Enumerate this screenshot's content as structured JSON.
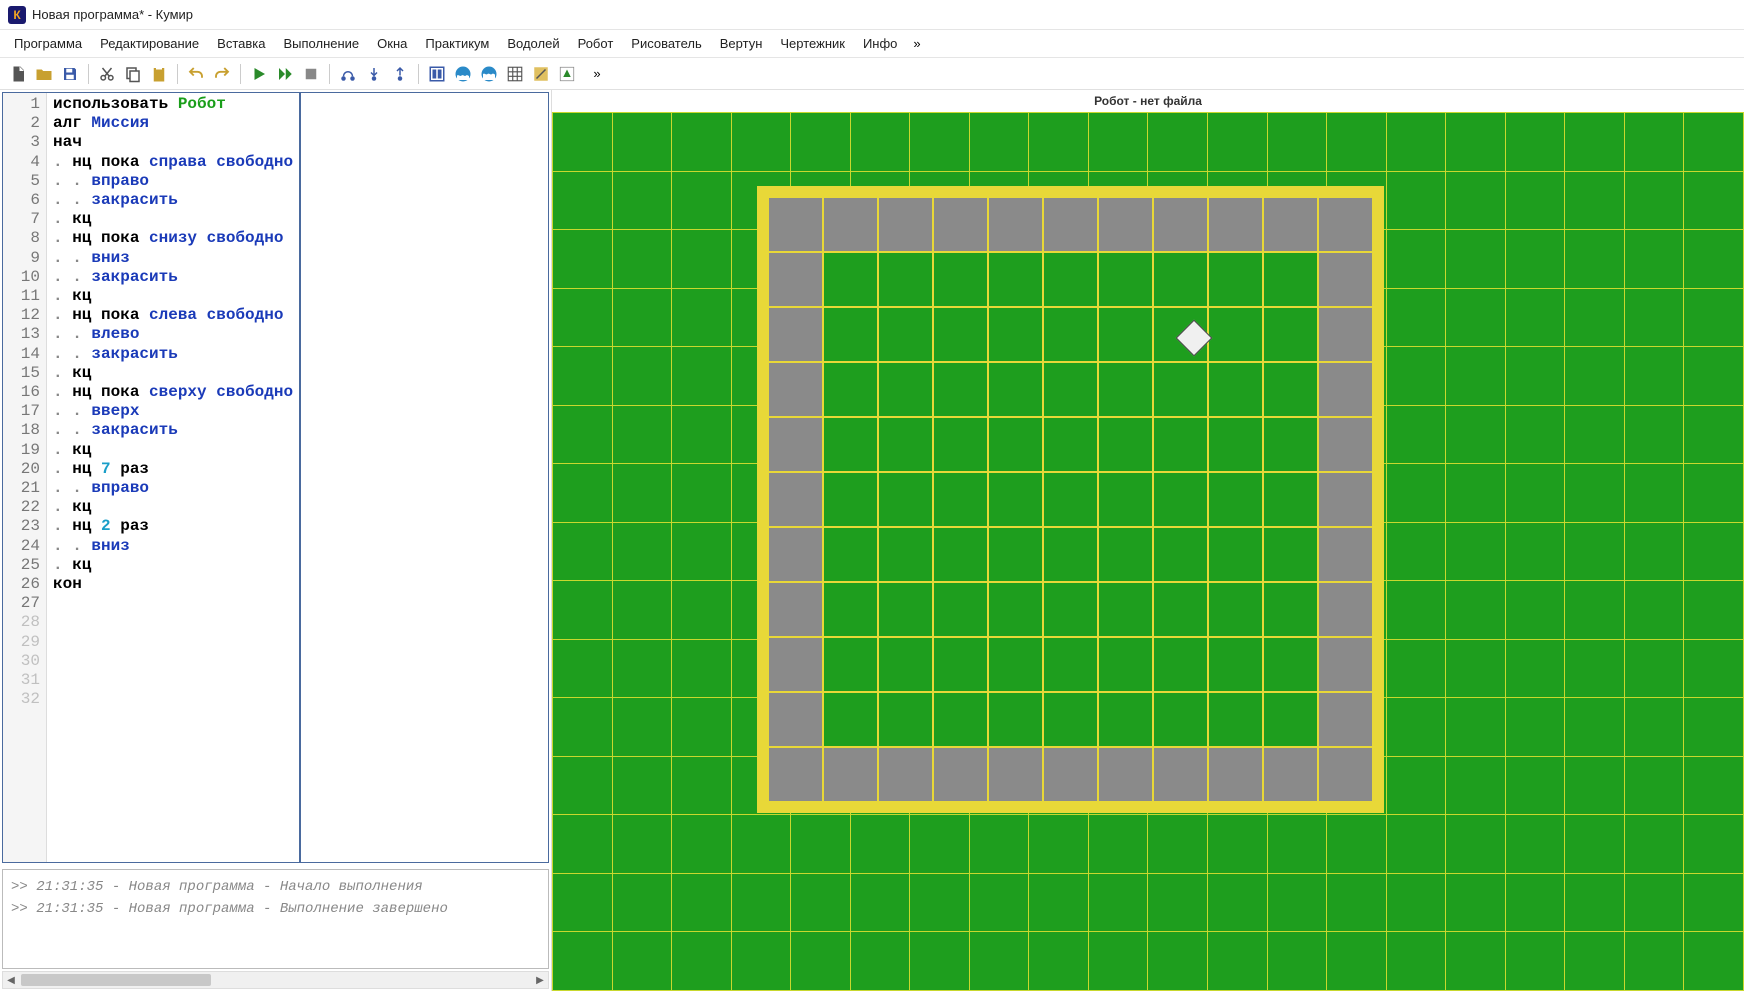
{
  "title": "Новая программа* - Кумир",
  "app_icon_letter": "К",
  "menu": [
    "Программа",
    "Редактирование",
    "Вставка",
    "Выполнение",
    "Окна",
    "Практикум",
    "Водолей",
    "Робот",
    "Рисователь",
    "Вертун",
    "Чертежник",
    "Инфо"
  ],
  "menu_more": "»",
  "toolbar_more": "»",
  "code_lines": [
    [
      {
        "t": "использовать ",
        "c": "kw-black"
      },
      {
        "t": "Робот",
        "c": "kw-green"
      }
    ],
    [
      {
        "t": "алг ",
        "c": "kw-black"
      },
      {
        "t": "Миссия",
        "c": "kw-blue"
      }
    ],
    [
      {
        "t": "нач",
        "c": "kw-black"
      }
    ],
    [
      {
        "t": ". ",
        "c": "dot"
      },
      {
        "t": "нц пока ",
        "c": "kw-black"
      },
      {
        "t": "справа свободно",
        "c": "kw-blue"
      }
    ],
    [
      {
        "t": ". . ",
        "c": "dot"
      },
      {
        "t": "вправо",
        "c": "kw-blue"
      }
    ],
    [
      {
        "t": ". . ",
        "c": "dot"
      },
      {
        "t": "закрасить",
        "c": "kw-blue"
      }
    ],
    [
      {
        "t": ". ",
        "c": "dot"
      },
      {
        "t": "кц",
        "c": "kw-black"
      }
    ],
    [
      {
        "t": ". ",
        "c": "dot"
      },
      {
        "t": "нц пока ",
        "c": "kw-black"
      },
      {
        "t": "снизу свободно",
        "c": "kw-blue"
      }
    ],
    [
      {
        "t": ". . ",
        "c": "dot"
      },
      {
        "t": "вниз",
        "c": "kw-blue"
      }
    ],
    [
      {
        "t": ". . ",
        "c": "dot"
      },
      {
        "t": "закрасить",
        "c": "kw-blue"
      }
    ],
    [
      {
        "t": ". ",
        "c": "dot"
      },
      {
        "t": "кц",
        "c": "kw-black"
      }
    ],
    [
      {
        "t": ". ",
        "c": "dot"
      },
      {
        "t": "нц пока ",
        "c": "kw-black"
      },
      {
        "t": "слева свободно",
        "c": "kw-blue"
      }
    ],
    [
      {
        "t": ". . ",
        "c": "dot"
      },
      {
        "t": "влево",
        "c": "kw-blue"
      }
    ],
    [
      {
        "t": ". . ",
        "c": "dot"
      },
      {
        "t": "закрасить",
        "c": "kw-blue"
      }
    ],
    [
      {
        "t": ". ",
        "c": "dot"
      },
      {
        "t": "кц",
        "c": "kw-black"
      }
    ],
    [
      {
        "t": ". ",
        "c": "dot"
      },
      {
        "t": "нц пока ",
        "c": "kw-black"
      },
      {
        "t": "сверху свободно",
        "c": "kw-blue"
      }
    ],
    [
      {
        "t": ". . ",
        "c": "dot"
      },
      {
        "t": "вверх",
        "c": "kw-blue"
      }
    ],
    [
      {
        "t": ". . ",
        "c": "dot"
      },
      {
        "t": "закрасить",
        "c": "kw-blue"
      }
    ],
    [
      {
        "t": ". ",
        "c": "dot"
      },
      {
        "t": "кц",
        "c": "kw-black"
      }
    ],
    [
      {
        "t": ". ",
        "c": "dot"
      },
      {
        "t": "нц ",
        "c": "kw-black"
      },
      {
        "t": "7",
        "c": "kw-cyan"
      },
      {
        "t": " раз",
        "c": "kw-black"
      }
    ],
    [
      {
        "t": ". . ",
        "c": "dot"
      },
      {
        "t": "вправо",
        "c": "kw-blue"
      }
    ],
    [
      {
        "t": ". ",
        "c": "dot"
      },
      {
        "t": "кц",
        "c": "kw-black"
      }
    ],
    [
      {
        "t": ". ",
        "c": "dot"
      },
      {
        "t": "нц ",
        "c": "kw-black"
      },
      {
        "t": "2",
        "c": "kw-cyan"
      },
      {
        "t": " раз",
        "c": "kw-black"
      }
    ],
    [
      {
        "t": ". . ",
        "c": "dot"
      },
      {
        "t": "вниз",
        "c": "kw-blue"
      }
    ],
    [
      {
        "t": ". ",
        "c": "dot"
      },
      {
        "t": "кц",
        "c": "kw-black"
      }
    ],
    [
      {
        "t": "кон",
        "c": "kw-black"
      }
    ],
    []
  ],
  "line_count": 27,
  "dim_lines": [
    28,
    29,
    30,
    31,
    32
  ],
  "console_lines": [
    ">> 21:31:35 - Новая программа - Начало выполнения",
    ">> 21:31:35 - Новая программа - Выполнение завершено"
  ],
  "robot_header": "Робот - нет файла",
  "field": {
    "cols": 11,
    "rows": 11,
    "painted": [
      [
        0,
        0
      ],
      [
        0,
        1
      ],
      [
        0,
        2
      ],
      [
        0,
        3
      ],
      [
        0,
        4
      ],
      [
        0,
        5
      ],
      [
        0,
        6
      ],
      [
        0,
        7
      ],
      [
        0,
        8
      ],
      [
        0,
        9
      ],
      [
        0,
        10
      ],
      [
        1,
        0
      ],
      [
        1,
        10
      ],
      [
        2,
        0
      ],
      [
        2,
        10
      ],
      [
        3,
        0
      ],
      [
        3,
        10
      ],
      [
        4,
        0
      ],
      [
        4,
        10
      ],
      [
        5,
        0
      ],
      [
        5,
        10
      ],
      [
        6,
        0
      ],
      [
        6,
        10
      ],
      [
        7,
        0
      ],
      [
        7,
        10
      ],
      [
        8,
        0
      ],
      [
        8,
        10
      ],
      [
        9,
        0
      ],
      [
        9,
        10
      ],
      [
        10,
        0
      ],
      [
        10,
        1
      ],
      [
        10,
        2
      ],
      [
        10,
        3
      ],
      [
        10,
        4
      ],
      [
        10,
        5
      ],
      [
        10,
        6
      ],
      [
        10,
        7
      ],
      [
        10,
        8
      ],
      [
        10,
        9
      ],
      [
        10,
        10
      ]
    ],
    "robot_row": 2,
    "robot_col": 7
  }
}
